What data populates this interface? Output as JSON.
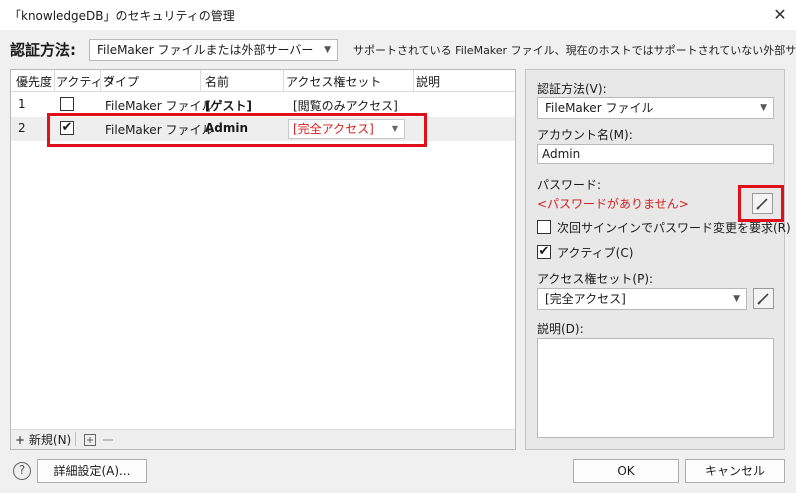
{
  "window": {
    "title": "「knowledgeDB」のセキュリティの管理",
    "close_symbol": "✕"
  },
  "auth": {
    "label": "認証方法:",
    "selected": "FileMaker ファイルまたは外部サーバー",
    "description": "サポートされている FileMaker ファイル、現在のホストではサポートされていない外部サーバー"
  },
  "table": {
    "headers": [
      "優先度",
      "アクティブ",
      "タイプ",
      "名前",
      "アクセス権セット",
      "説明"
    ],
    "rows": [
      {
        "priority": "1",
        "active": false,
        "type": "FileMaker ファイル",
        "name": "[ゲスト]",
        "privilege": "[閲覧のみアクセス]"
      },
      {
        "priority": "2",
        "active": true,
        "type": "FileMaker ファイル",
        "name": "Admin",
        "privilege": "[完全アクセス]"
      }
    ]
  },
  "footer_toolbar": {
    "new_label": "新規(N)",
    "plus_symbol": "+"
  },
  "detail": {
    "auth_method_label": "認証方法(V):",
    "auth_method_value": "FileMaker ファイル",
    "account_label": "アカウント名(M):",
    "account_value": "Admin",
    "password_label": "パスワード:",
    "password_status": "<パスワードがありません>",
    "require_change_label": "次回サインインでパスワード変更を要求(R)",
    "require_change_checked": false,
    "active_label": "アクティブ(C)",
    "active_checked": true,
    "privilege_label": "アクセス権セット(P):",
    "privilege_value": "[完全アクセス]",
    "description_label": "説明(D):",
    "description_value": ""
  },
  "buttons": {
    "help": "?",
    "advanced": "詳細設定(A)...",
    "ok": "OK",
    "cancel": "キャンセル"
  },
  "colors": {
    "highlight": "#e0101a",
    "privilege_text": "#d42020"
  }
}
